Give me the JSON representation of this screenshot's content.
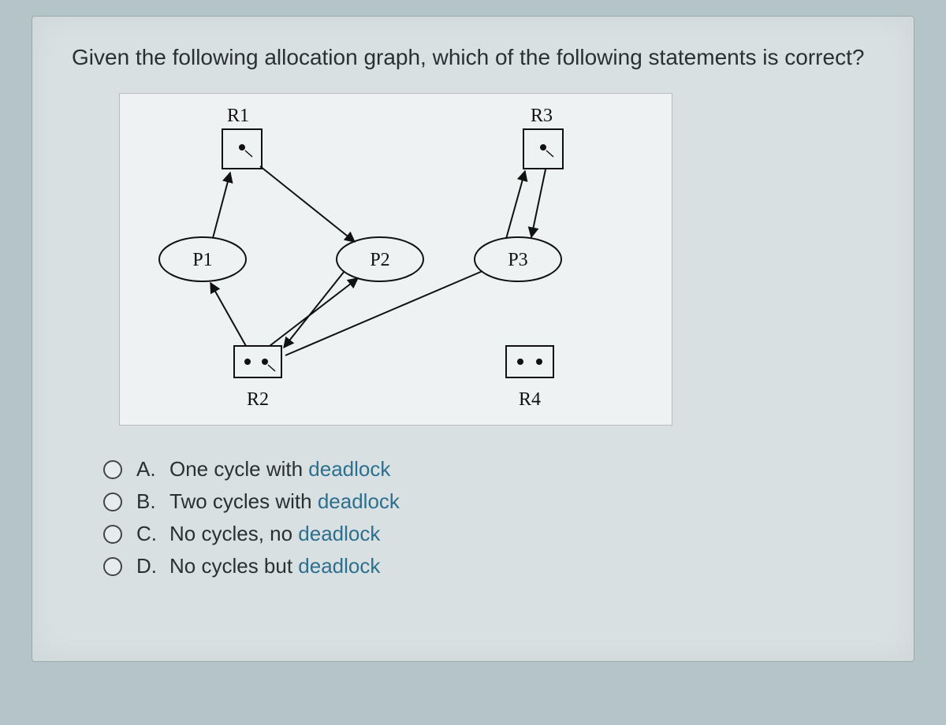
{
  "question": "Given the following allocation graph, which of the following statements is correct?",
  "graph": {
    "resources": {
      "R1": "R1",
      "R2": "R2",
      "R3": "R3",
      "R4": "R4"
    },
    "processes": {
      "P1": "P1",
      "P2": "P2",
      "P3": "P3"
    }
  },
  "options": [
    {
      "letter": "A.",
      "plain": "One cycle with ",
      "highlight": "deadlock"
    },
    {
      "letter": "B.",
      "plain": "Two cycles with ",
      "highlight": "deadlock"
    },
    {
      "letter": "C.",
      "plain": "No cycles, no ",
      "highlight": "deadlock"
    },
    {
      "letter": "D.",
      "plain": "No cycles but ",
      "highlight": "deadlock"
    }
  ]
}
